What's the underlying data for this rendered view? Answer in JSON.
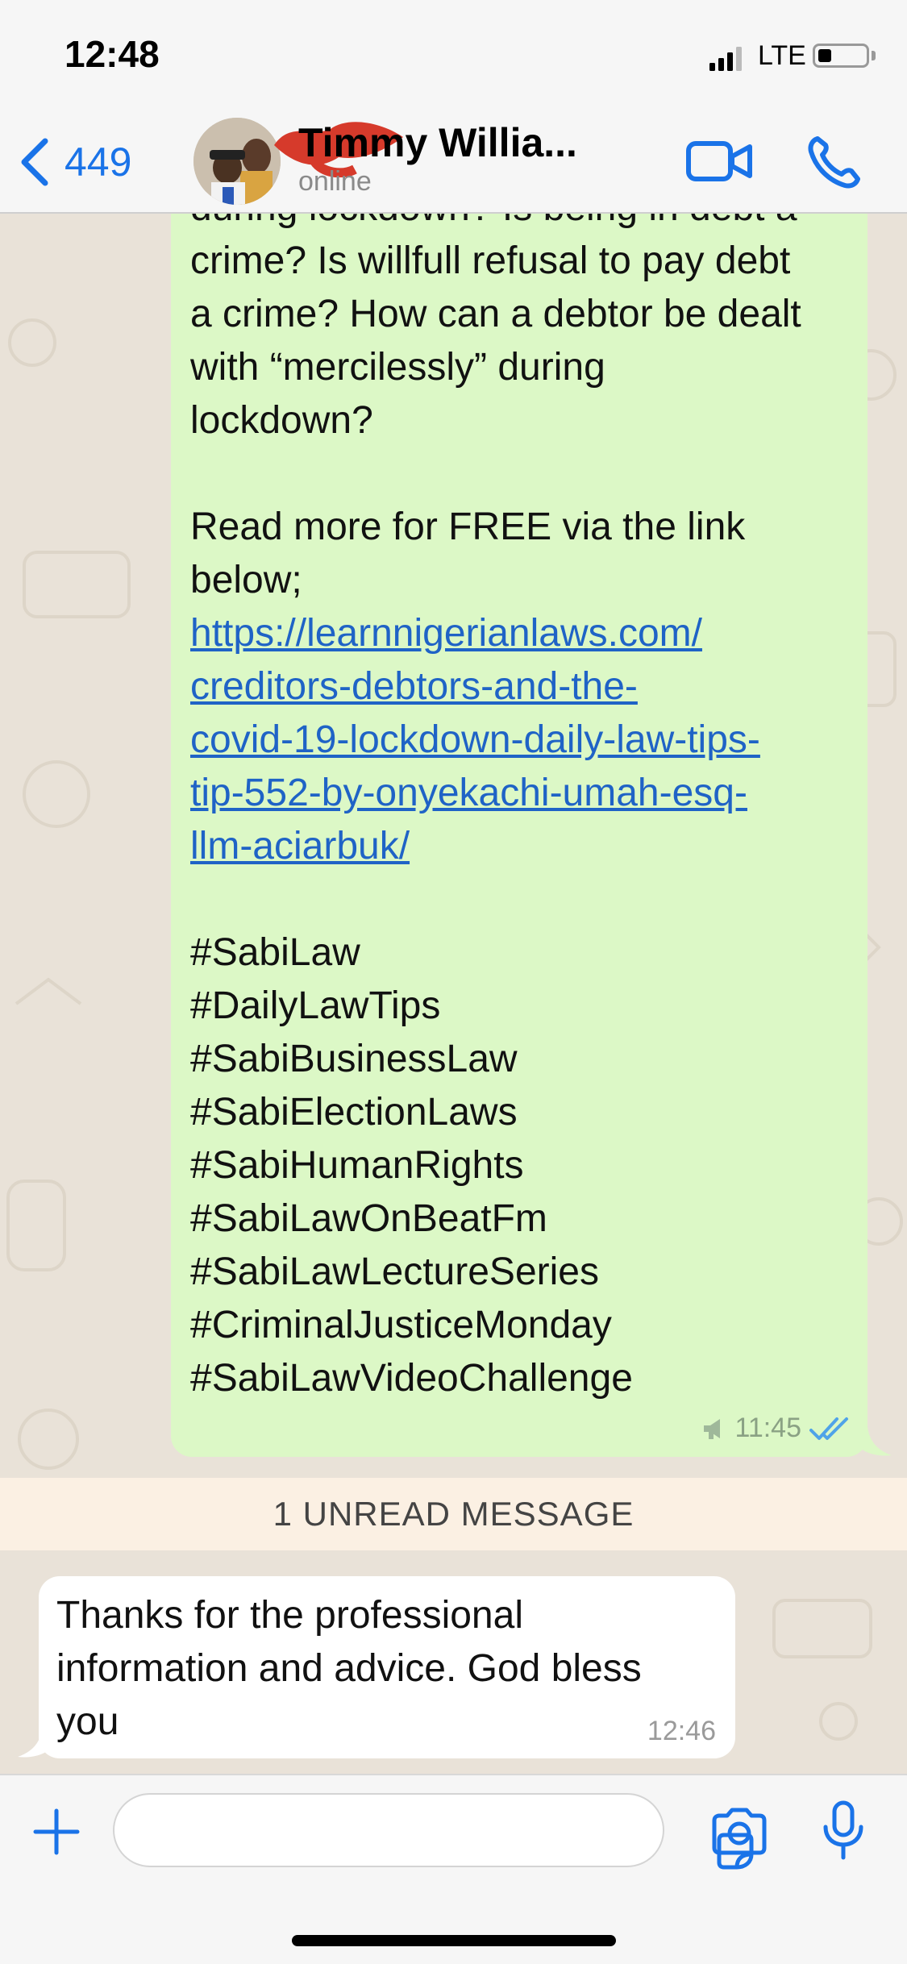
{
  "status_bar": {
    "time": "12:48",
    "network": "LTE"
  },
  "header": {
    "back_count": "449",
    "contact_name": "Timmy Willia...",
    "contact_status": "online"
  },
  "outgoing_message": {
    "lines": [
      {
        "text": "during lockdown? Is being in debt a",
        "link": false
      },
      {
        "text": "crime? Is willfull refusal to pay debt",
        "link": false
      },
      {
        "text": "a crime? How can a debtor be dealt",
        "link": false
      },
      {
        "text": "with “mercilessly” during",
        "link": false
      },
      {
        "text": "lockdown?",
        "link": false
      },
      {
        "text": "",
        "link": false
      },
      {
        "text": "Read more for FREE via the link",
        "link": false
      },
      {
        "text": "below;",
        "link": false
      },
      {
        "text": "https://learnnigerianlaws.com/",
        "link": true
      },
      {
        "text": "creditors-debtors-and-the-",
        "link": true
      },
      {
        "text": "covid-19-lockdown-daily-law-tips-",
        "link": true
      },
      {
        "text": "tip-552-by-onyekachi-umah-esq-",
        "link": true
      },
      {
        "text": "llm-aciarbuk/",
        "link": true
      },
      {
        "text": "",
        "link": false
      },
      {
        "text": "#SabiLaw",
        "link": false
      },
      {
        "text": "#DailyLawTips",
        "link": false
      },
      {
        "text": "#SabiBusinessLaw",
        "link": false
      },
      {
        "text": "#SabiElectionLaws",
        "link": false
      },
      {
        "text": "#SabiHumanRights",
        "link": false
      },
      {
        "text": "#SabiLawOnBeatFm",
        "link": false
      },
      {
        "text": "#SabiLawLectureSeries",
        "link": false
      },
      {
        "text": "#CriminalJusticeMonday",
        "link": false
      },
      {
        "text": "#SabiLawVideoChallenge",
        "link": false
      }
    ],
    "time": "11:45"
  },
  "unread_banner": "1 UNREAD MESSAGE",
  "incoming_message": {
    "lines": [
      "Thanks for the professional",
      "information and advice. God bless",
      "you"
    ],
    "time": "12:46"
  },
  "composer": {
    "placeholder": ""
  },
  "colors": {
    "accent": "#1a73e8",
    "outgoing_bubble": "#dcf8c6",
    "incoming_bubble": "#ffffff",
    "chat_background": "#e9e2d8",
    "unread_band": "#fbf0e3",
    "link": "#1f63c6"
  },
  "icons": [
    "chevron-left-icon",
    "video-camera-icon",
    "phone-icon",
    "broadcast-speaker-icon",
    "double-check-icon",
    "plus-icon",
    "sticker-icon",
    "camera-icon",
    "microphone-icon"
  ]
}
